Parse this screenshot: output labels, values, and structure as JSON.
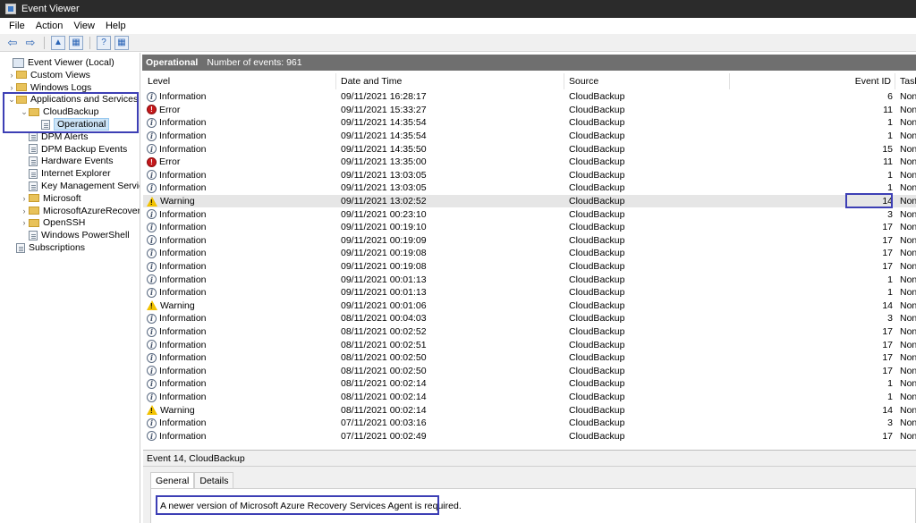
{
  "window": {
    "title": "Event Viewer"
  },
  "menu": [
    "File",
    "Action",
    "View",
    "Help"
  ],
  "toolbar": {
    "icons": [
      "back-arrow-icon",
      "forward-arrow-icon",
      "folder-up-icon",
      "show-hide-tree-icon",
      "help-icon",
      "properties-icon"
    ]
  },
  "tree": {
    "items": [
      {
        "label": "Event Viewer (Local)",
        "level": 0,
        "icon": "event-viewer-icon",
        "chevron": ""
      },
      {
        "label": "Custom Views",
        "level": 1,
        "icon": "folder",
        "chevron": ">"
      },
      {
        "label": "Windows Logs",
        "level": 1,
        "icon": "folder",
        "chevron": ">"
      },
      {
        "label": "Applications and Services Lo",
        "level": 1,
        "icon": "folder",
        "chevron": "v"
      },
      {
        "label": "CloudBackup",
        "level": 2,
        "icon": "folder",
        "chevron": "v"
      },
      {
        "label": "Operational",
        "level": 3,
        "icon": "log",
        "chevron": "",
        "selected": true
      },
      {
        "label": "DPM Alerts",
        "level": 2,
        "icon": "log",
        "chevron": ""
      },
      {
        "label": "DPM Backup Events",
        "level": 2,
        "icon": "log",
        "chevron": ""
      },
      {
        "label": "Hardware Events",
        "level": 2,
        "icon": "log",
        "chevron": ""
      },
      {
        "label": "Internet Explorer",
        "level": 2,
        "icon": "log",
        "chevron": ""
      },
      {
        "label": "Key Management Service",
        "level": 2,
        "icon": "log",
        "chevron": ""
      },
      {
        "label": "Microsoft",
        "level": 2,
        "icon": "folder",
        "chevron": ">"
      },
      {
        "label": "MicrosoftAzureRecovery",
        "level": 2,
        "icon": "folder",
        "chevron": ">"
      },
      {
        "label": "OpenSSH",
        "level": 2,
        "icon": "folder",
        "chevron": ">"
      },
      {
        "label": "Windows PowerShell",
        "level": 2,
        "icon": "log",
        "chevron": ""
      },
      {
        "label": "Subscriptions",
        "level": 1,
        "icon": "log",
        "chevron": ""
      }
    ]
  },
  "panel": {
    "title": "Operational",
    "count_text": "Number of events: 961"
  },
  "grid": {
    "columns": [
      "Level",
      "Date and Time",
      "Source",
      "Event ID",
      "Task"
    ],
    "rows": [
      {
        "level": "Information",
        "date": "09/11/2021 16:28:17",
        "source": "CloudBackup",
        "id": "6",
        "task": "Non"
      },
      {
        "level": "Error",
        "date": "09/11/2021 15:33:27",
        "source": "CloudBackup",
        "id": "11",
        "task": "Non"
      },
      {
        "level": "Information",
        "date": "09/11/2021 14:35:54",
        "source": "CloudBackup",
        "id": "1",
        "task": "Non"
      },
      {
        "level": "Information",
        "date": "09/11/2021 14:35:54",
        "source": "CloudBackup",
        "id": "1",
        "task": "Non"
      },
      {
        "level": "Information",
        "date": "09/11/2021 14:35:50",
        "source": "CloudBackup",
        "id": "15",
        "task": "Non"
      },
      {
        "level": "Error",
        "date": "09/11/2021 13:35:00",
        "source": "CloudBackup",
        "id": "11",
        "task": "Non"
      },
      {
        "level": "Information",
        "date": "09/11/2021 13:03:05",
        "source": "CloudBackup",
        "id": "1",
        "task": "Non"
      },
      {
        "level": "Information",
        "date": "09/11/2021 13:03:05",
        "source": "CloudBackup",
        "id": "1",
        "task": "Non"
      },
      {
        "level": "Warning",
        "date": "09/11/2021 13:02:52",
        "source": "CloudBackup",
        "id": "14",
        "task": "Non",
        "selected": true
      },
      {
        "level": "Information",
        "date": "09/11/2021 00:23:10",
        "source": "CloudBackup",
        "id": "3",
        "task": "Non"
      },
      {
        "level": "Information",
        "date": "09/11/2021 00:19:10",
        "source": "CloudBackup",
        "id": "17",
        "task": "Non"
      },
      {
        "level": "Information",
        "date": "09/11/2021 00:19:09",
        "source": "CloudBackup",
        "id": "17",
        "task": "Non"
      },
      {
        "level": "Information",
        "date": "09/11/2021 00:19:08",
        "source": "CloudBackup",
        "id": "17",
        "task": "Non"
      },
      {
        "level": "Information",
        "date": "09/11/2021 00:19:08",
        "source": "CloudBackup",
        "id": "17",
        "task": "Non"
      },
      {
        "level": "Information",
        "date": "09/11/2021 00:01:13",
        "source": "CloudBackup",
        "id": "1",
        "task": "Non"
      },
      {
        "level": "Information",
        "date": "09/11/2021 00:01:13",
        "source": "CloudBackup",
        "id": "1",
        "task": "Non"
      },
      {
        "level": "Warning",
        "date": "09/11/2021 00:01:06",
        "source": "CloudBackup",
        "id": "14",
        "task": "Non"
      },
      {
        "level": "Information",
        "date": "08/11/2021 00:04:03",
        "source": "CloudBackup",
        "id": "3",
        "task": "Non"
      },
      {
        "level": "Information",
        "date": "08/11/2021 00:02:52",
        "source": "CloudBackup",
        "id": "17",
        "task": "Non"
      },
      {
        "level": "Information",
        "date": "08/11/2021 00:02:51",
        "source": "CloudBackup",
        "id": "17",
        "task": "Non"
      },
      {
        "level": "Information",
        "date": "08/11/2021 00:02:50",
        "source": "CloudBackup",
        "id": "17",
        "task": "Non"
      },
      {
        "level": "Information",
        "date": "08/11/2021 00:02:50",
        "source": "CloudBackup",
        "id": "17",
        "task": "Non"
      },
      {
        "level": "Information",
        "date": "08/11/2021 00:02:14",
        "source": "CloudBackup",
        "id": "1",
        "task": "Non"
      },
      {
        "level": "Information",
        "date": "08/11/2021 00:02:14",
        "source": "CloudBackup",
        "id": "1",
        "task": "Non"
      },
      {
        "level": "Warning",
        "date": "08/11/2021 00:02:14",
        "source": "CloudBackup",
        "id": "14",
        "task": "Non"
      },
      {
        "level": "Information",
        "date": "07/11/2021 00:03:16",
        "source": "CloudBackup",
        "id": "3",
        "task": "Non"
      },
      {
        "level": "Information",
        "date": "07/11/2021 00:02:49",
        "source": "CloudBackup",
        "id": "17",
        "task": "Non"
      }
    ]
  },
  "details": {
    "header": "Event 14, CloudBackup",
    "tabs": [
      "General",
      "Details"
    ],
    "message": "A newer version of Microsoft Azure Recovery Services Agent is required."
  },
  "colors": {
    "highlight_border": "#3d3fb5",
    "panel_header": "#6f6f6f",
    "error_red": "#c5181b",
    "warning_yellow": "#f2c200"
  }
}
